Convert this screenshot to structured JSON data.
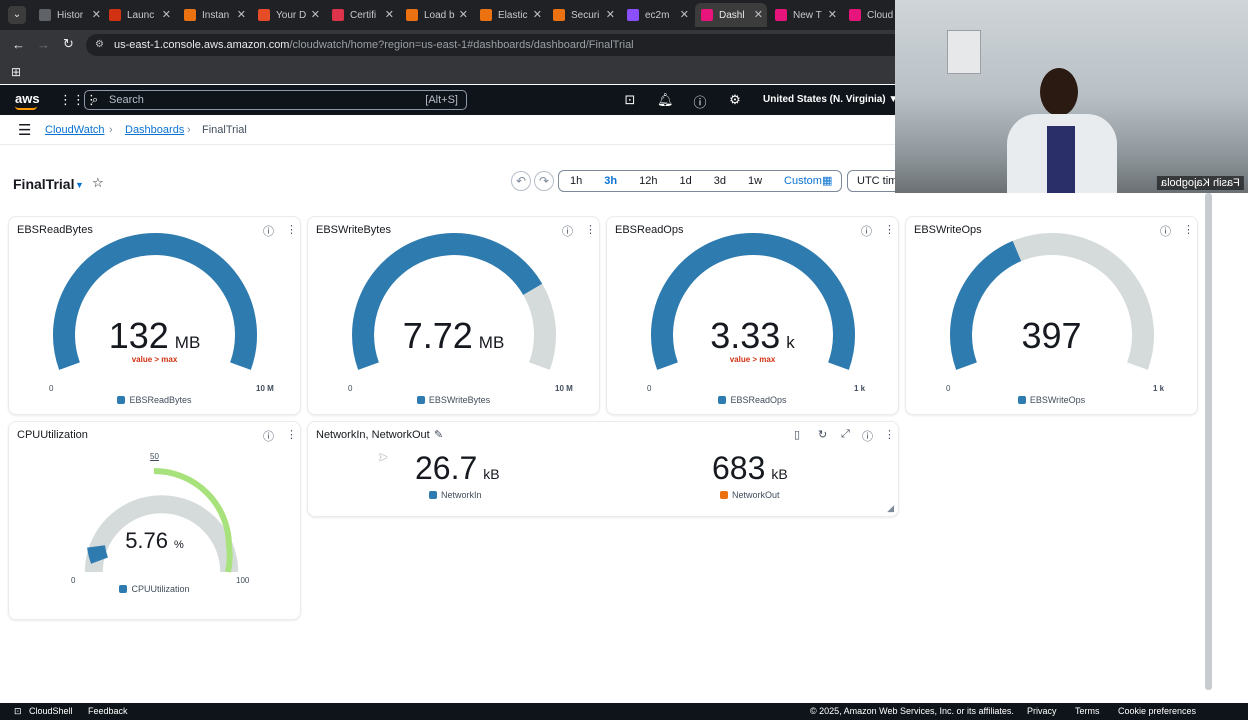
{
  "browser": {
    "tabs": [
      {
        "label": "Histor",
        "color": "#5f6368"
      },
      {
        "label": "Launc",
        "color": "#d13212"
      },
      {
        "label": "Instan",
        "color": "#ec7211"
      },
      {
        "label": "Your D",
        "color": "#e44d26"
      },
      {
        "label": "Certifi",
        "color": "#dd344c"
      },
      {
        "label": "Load b",
        "color": "#ec7211"
      },
      {
        "label": "Elastic",
        "color": "#ec7211"
      },
      {
        "label": "Securi",
        "color": "#ec7211"
      },
      {
        "label": "ec2m",
        "color": "#8c4fff"
      },
      {
        "label": "Dashl",
        "color": "#e7157b",
        "active": true
      },
      {
        "label": "New T",
        "color": "#e7157b"
      },
      {
        "label": "Cloud",
        "color": "#e7157b"
      }
    ],
    "url_host": "us-east-1.console.aws.amazon.com",
    "url_path": "/cloudwatch/home?region=us-east-1#dashboards/dashboard/FinalTrial"
  },
  "aws_header": {
    "logo": "aws",
    "search_placeholder": "Search",
    "search_shortcut": "[Alt+S]",
    "region": "United States (N. Virginia) ▼"
  },
  "breadcrumbs": {
    "cloudwatch": "CloudWatch",
    "dashboards": "Dashboards",
    "current": "FinalTrial"
  },
  "dashboard": {
    "title": "FinalTrial",
    "ranges": [
      "1h",
      "3h",
      "12h",
      "1d",
      "3d",
      "1w",
      "Custom"
    ],
    "selected_range": "3h",
    "timezone": "UTC time"
  },
  "widgets": {
    "ebs_read_bytes": {
      "title": "EBSReadBytes",
      "value": "132",
      "unit": "MB",
      "warning": "value > max",
      "min": "0",
      "max": "10 M",
      "legend": "EBSReadBytes",
      "fill_fraction": 1.0
    },
    "ebs_write_bytes": {
      "title": "EBSWriteBytes",
      "value": "7.72",
      "unit": "MB",
      "min": "0",
      "max": "10 M",
      "legend": "EBSWriteBytes",
      "fill_fraction": 0.772
    },
    "ebs_read_ops": {
      "title": "EBSReadOps",
      "value": "3.33",
      "unit": "k",
      "warning": "value > max",
      "min": "0",
      "max": "1 k",
      "legend": "EBSReadOps",
      "fill_fraction": 1.0
    },
    "ebs_write_ops": {
      "title": "EBSWriteOps",
      "value": "397",
      "unit": "",
      "min": "0",
      "max": "1 k",
      "legend": "EBSWriteOps",
      "fill_fraction": 0.397
    },
    "cpu": {
      "title": "CPUUtilization",
      "value": "5.76",
      "unit": "%",
      "min": "0",
      "mid": "50",
      "max": "100",
      "legend": "CPUUtilization",
      "fill_fraction": 0.0576
    },
    "network": {
      "title": "NetworkIn, NetworkOut",
      "in_value": "26.7",
      "in_unit": "kB",
      "in_legend": "NetworkIn",
      "out_value": "683",
      "out_unit": "kB",
      "out_legend": "NetworkOut"
    }
  },
  "colors": {
    "blue": "#2e7bb0",
    "track": "#d5dbdb",
    "orange": "#ec7211",
    "green": "#a8e27c",
    "link": "#0972d3"
  },
  "webcam_caption": "Fasih Kajogbola",
  "footer": {
    "cloudshell": "CloudShell",
    "feedback": "Feedback",
    "copyright": "© 2025, Amazon Web Services, Inc. or its affiliates.",
    "privacy": "Privacy",
    "terms": "Terms",
    "cookies": "Cookie preferences"
  }
}
